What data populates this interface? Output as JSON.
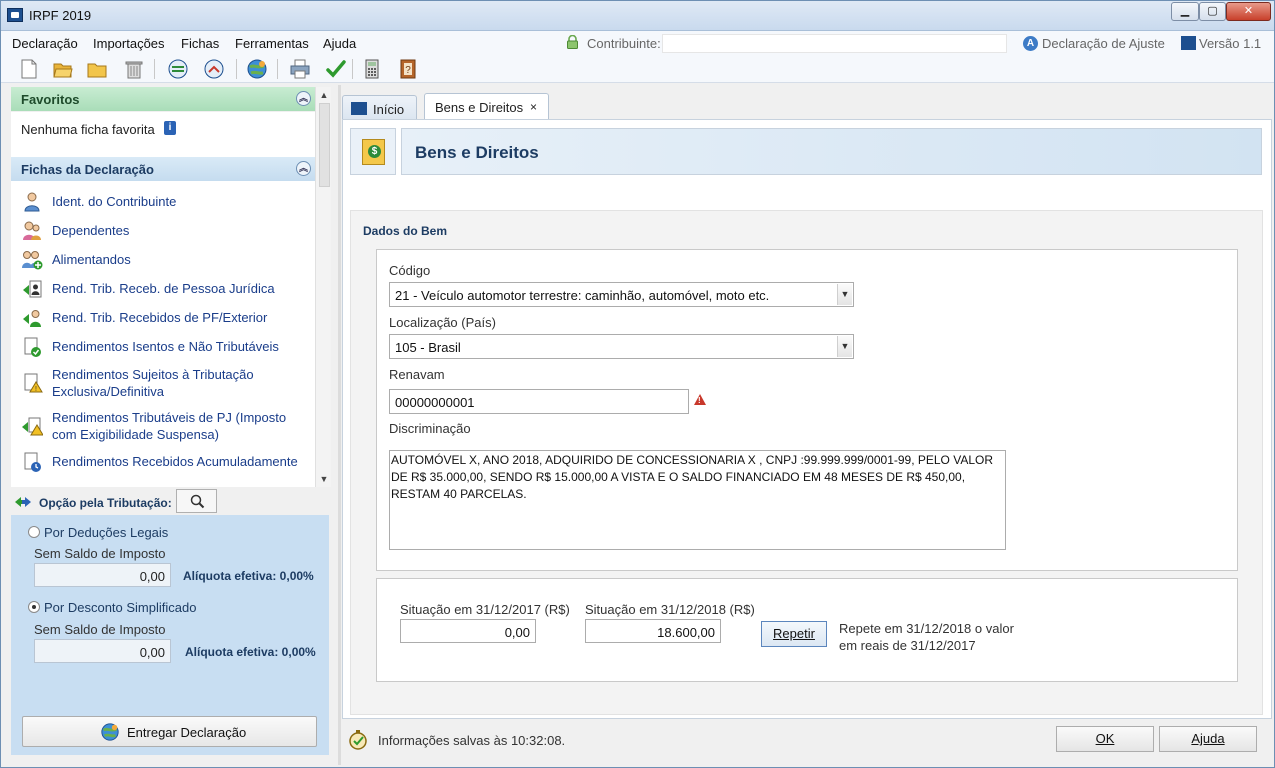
{
  "window": {
    "title": "IRPF 2019"
  },
  "menu": {
    "items": [
      "Declaração",
      "Importações",
      "Fichas",
      "Ferramentas",
      "Ajuda"
    ]
  },
  "header": {
    "contribuinte_label": "Contribuinte:",
    "contribuinte_value": "",
    "declaracao_tipo": "Declaração de Ajuste",
    "versao": "Versão 1.1"
  },
  "toolbar": {
    "icons": [
      "new-file-icon",
      "open-folder-icon",
      "folder-icon",
      "trash-icon",
      "import-icon",
      "export-icon",
      "globe-transmit-icon",
      "print-icon",
      "check-icon",
      "calculator-icon",
      "help-book-icon"
    ]
  },
  "sidebar": {
    "favoritos_title": "Favoritos",
    "favoritos_empty": "Nenhuma ficha favorita",
    "fichas_title": "Fichas da Declaração",
    "fichas": [
      {
        "label": "Ident. do Contribuinte"
      },
      {
        "label": "Dependentes"
      },
      {
        "label": "Alimentandos"
      },
      {
        "label": "Rend. Trib. Receb. de Pessoa Jurídica"
      },
      {
        "label": "Rend. Trib. Recebidos de PF/Exterior"
      },
      {
        "label": "Rendimentos Isentos e Não Tributáveis"
      },
      {
        "label": "Rendimentos Sujeitos à Tributação Exclusiva/Definitiva"
      },
      {
        "label": "Rendimentos Tributáveis de PJ (Imposto com Exigibilidade Suspensa)"
      },
      {
        "label": "Rendimentos Recebidos Acumuladamente"
      }
    ]
  },
  "opcao": {
    "title": "Opção pela Tributação:",
    "deducoes_label": "Por Deduções Legais",
    "deducoes_sub": "Sem Saldo de Imposto",
    "deducoes_valor": "0,00",
    "deducoes_aliquota": "Alíquota efetiva: 0,00%",
    "simplificado_label": "Por Desconto Simplificado",
    "simplificado_sub": "Sem Saldo de Imposto",
    "simplificado_valor": "0,00",
    "simplificado_aliquota": "Alíquota efetiva: 0,00%",
    "selected": "simplificado",
    "entregar_label": "Entregar Declaração"
  },
  "tabs": {
    "inicio": "Início",
    "bens": "Bens e Direitos",
    "close_glyph": "×"
  },
  "banner": {
    "title": "Bens e Direitos"
  },
  "form": {
    "section_title": "Dados do Bem",
    "codigo_label": "Código",
    "codigo_value": "21 - Veículo automotor terrestre: caminhão, automóvel, moto etc.",
    "localizacao_label": "Localização (País)",
    "localizacao_value": "105 - Brasil",
    "renavam_label": "Renavam",
    "renavam_value": "00000000001",
    "discriminacao_label": "Discriminação",
    "discriminacao_value": "AUTOMÓVEL X, ANO 2018, ADQUIRIDO DE CONCESSIONARIA X , CNPJ :99.999.999/0001-99, PELO VALOR\nDE R$ 35.000,00, SENDO R$ 15.000,00 A VISTA E O SALDO FINANCIADO EM 48 MESES DE R$ 450,00,\nRESTAM 40 PARCELAS.",
    "situacao_2017_label": "Situação em 31/12/2017 (R$)",
    "situacao_2017_value": "0,00",
    "situacao_2018_label": "Situação em 31/12/2018 (R$)",
    "situacao_2018_value": "18.600,00",
    "repetir_label": "Repetir",
    "repete_text": "Repete em 31/12/2018 o valor em reais de 31/12/2017"
  },
  "footer": {
    "status": "Informações salvas às 10:32:08.",
    "ok_label": "OK",
    "ajuda_label": "Ajuda"
  }
}
